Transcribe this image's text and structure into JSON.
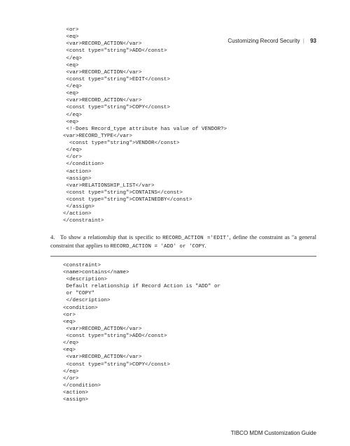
{
  "header": {
    "section": "Customizing Record Security",
    "page": "93"
  },
  "codeBlock1": " <or>\n <eq>\n <var>RECORD_ACTION</var>\n <const type=\"string\">ADD</const>\n </eq>\n <eq>\n <var>RECORD_ACTION</var>\n <const type=\"string\">EDIT</const>\n </eq>\n <eq>\n <var>RECORD_ACTION</var>\n <const type=\"string\">COPY</const>\n </eq>\n <eq>\n <!-Does Record_type attribute has value of VENDOR?>\n<var>RECORD_TYPE</var>\n  <const type=\"string\">VENDOR</const>\n </eq>\n </or>\n </condition>\n <action>\n <assign>\n <var>RELATIONSHIP_LIST</var>\n <const type=\"string\">CONTAINS</const>\n <const type=\"string\">CONTAINEDBY</const>\n </assign>\n</action>\n</constraint>",
  "step4": {
    "num": "4.",
    "textA": "To show a relationship that is specific to ",
    "codeA": "RECORD_ACTION ='EDIT'",
    "textB": ", define the constraint as \"a general constraint that applies to ",
    "codeB": "RECORD_ACTION = 'ADD' or 'COPY",
    "textC": "."
  },
  "codeBlock2": "<constraint>\n<name>contains</name>\n <description>\n Default relationship if Record Action is \"ADD\" or\n or \"COPY\"\n </description>\n<condition>\n<or>\n<eq>\n <var>RECORD_ACTION</var>\n <const type=\"string\">ADD</const>\n</eq>\n<eq>\n <var>RECORD_ACTION</var>\n <const type=\"string\">COPY</const>\n</eq>\n</or>\n</condition>\n<action>\n<assign>",
  "footer": "TIBCO MDM Customization Guide"
}
